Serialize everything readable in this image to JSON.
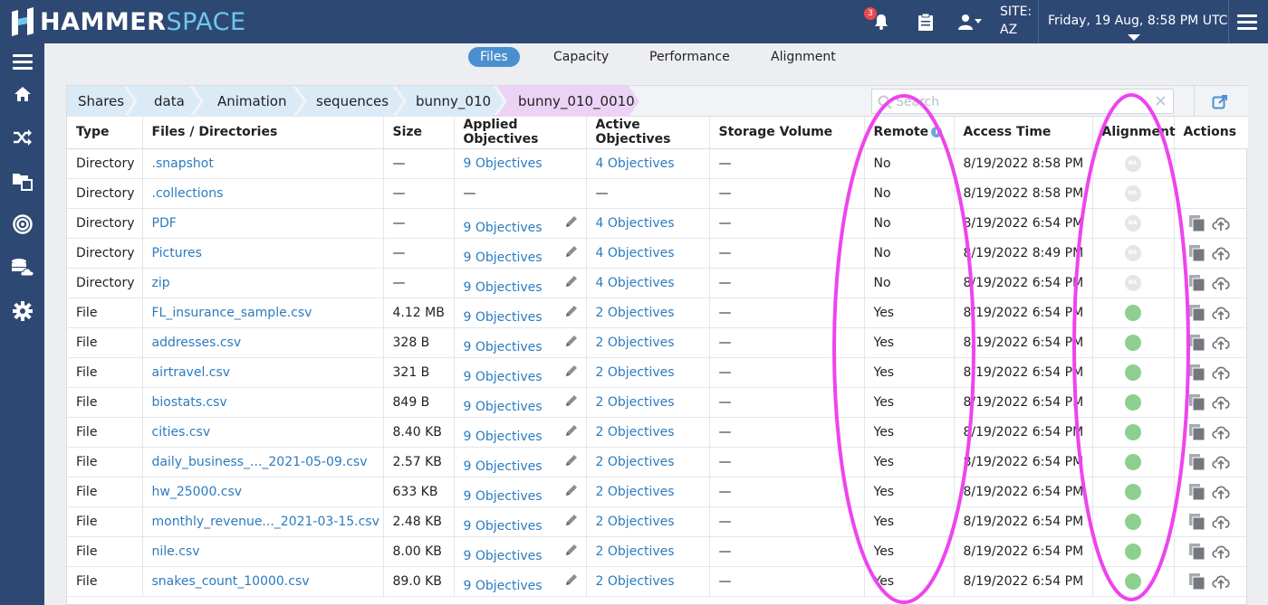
{
  "app": {
    "logo_hammer": "HAMMER",
    "logo_space": "SPACE",
    "notifications_count": "3",
    "site_label": "SITE:",
    "site_value": "AZ",
    "datetime": "Friday, 19 Aug, 8:58 PM UTC"
  },
  "tabs": [
    "Files",
    "Capacity",
    "Performance",
    "Alignment"
  ],
  "breadcrumb": [
    "Shares",
    "data",
    "Animation",
    "sequences",
    "bunny_010",
    "bunny_010_0010"
  ],
  "search": {
    "placeholder": "Search",
    "value": ""
  },
  "table": {
    "headers": {
      "type": "Type",
      "name": "Files / Directories",
      "size": "Size",
      "applied": "Applied Objectives",
      "active": "Active Objectives",
      "volume": "Storage Volume",
      "remote": "Remote",
      "access": "Access Time",
      "alignment": "Alignment",
      "actions": "Actions"
    },
    "rows": [
      {
        "type": "Directory",
        "name": ".snapshot",
        "size": "—",
        "applied": "9 Objectives",
        "applied_edit": false,
        "active": "4 Objectives",
        "volume": "—",
        "remote": "No",
        "access": "8/19/2022 8:58 PM",
        "alignment": "na",
        "actions": false
      },
      {
        "type": "Directory",
        "name": ".collections",
        "size": "—",
        "applied": "—",
        "applied_edit": false,
        "active": "—",
        "volume": "—",
        "remote": "No",
        "access": "8/19/2022 8:58 PM",
        "alignment": "na",
        "actions": false
      },
      {
        "type": "Directory",
        "name": "PDF",
        "size": "—",
        "applied": "9 Objectives",
        "applied_edit": true,
        "active": "4 Objectives",
        "volume": "—",
        "remote": "No",
        "access": "8/19/2022 6:54 PM",
        "alignment": "na",
        "actions": true
      },
      {
        "type": "Directory",
        "name": "Pictures",
        "size": "—",
        "applied": "9 Objectives",
        "applied_edit": true,
        "active": "4 Objectives",
        "volume": "—",
        "remote": "No",
        "access": "8/19/2022 8:49 PM",
        "alignment": "na",
        "actions": true
      },
      {
        "type": "Directory",
        "name": "zip",
        "size": "—",
        "applied": "9 Objectives",
        "applied_edit": true,
        "active": "4 Objectives",
        "volume": "—",
        "remote": "No",
        "access": "8/19/2022 6:54 PM",
        "alignment": "na",
        "actions": true
      },
      {
        "type": "File",
        "name": "FL_insurance_sample.csv",
        "size": "4.12 MB",
        "applied": "9 Objectives",
        "applied_edit": true,
        "active": "2 Objectives",
        "volume": "—",
        "remote": "Yes",
        "access": "8/19/2022 6:54 PM",
        "alignment": "aligned",
        "actions": true
      },
      {
        "type": "File",
        "name": "addresses.csv",
        "size": "328 B",
        "applied": "9 Objectives",
        "applied_edit": true,
        "active": "2 Objectives",
        "volume": "—",
        "remote": "Yes",
        "access": "8/19/2022 6:54 PM",
        "alignment": "aligned",
        "actions": true
      },
      {
        "type": "File",
        "name": "airtravel.csv",
        "size": "321 B",
        "applied": "9 Objectives",
        "applied_edit": true,
        "active": "2 Objectives",
        "volume": "—",
        "remote": "Yes",
        "access": "8/19/2022 6:54 PM",
        "alignment": "aligned",
        "actions": true
      },
      {
        "type": "File",
        "name": "biostats.csv",
        "size": "849 B",
        "applied": "9 Objectives",
        "applied_edit": true,
        "active": "2 Objectives",
        "volume": "—",
        "remote": "Yes",
        "access": "8/19/2022 6:54 PM",
        "alignment": "aligned",
        "actions": true
      },
      {
        "type": "File",
        "name": "cities.csv",
        "size": "8.40 KB",
        "applied": "9 Objectives",
        "applied_edit": true,
        "active": "2 Objectives",
        "volume": "—",
        "remote": "Yes",
        "access": "8/19/2022 6:54 PM",
        "alignment": "aligned",
        "actions": true
      },
      {
        "type": "File",
        "name": "daily_business_..._2021-05-09.csv",
        "size": "2.57 KB",
        "applied": "9 Objectives",
        "applied_edit": true,
        "active": "2 Objectives",
        "volume": "—",
        "remote": "Yes",
        "access": "8/19/2022 6:54 PM",
        "alignment": "aligned",
        "actions": true
      },
      {
        "type": "File",
        "name": "hw_25000.csv",
        "size": "633 KB",
        "applied": "9 Objectives",
        "applied_edit": true,
        "active": "2 Objectives",
        "volume": "—",
        "remote": "Yes",
        "access": "8/19/2022 6:54 PM",
        "alignment": "aligned",
        "actions": true
      },
      {
        "type": "File",
        "name": "monthly_revenue..._2021-03-15.csv",
        "size": "2.48 KB",
        "applied": "9 Objectives",
        "applied_edit": true,
        "active": "2 Objectives",
        "volume": "—",
        "remote": "Yes",
        "access": "8/19/2022 6:54 PM",
        "alignment": "aligned",
        "actions": true
      },
      {
        "type": "File",
        "name": "nile.csv",
        "size": "8.00 KB",
        "applied": "9 Objectives",
        "applied_edit": true,
        "active": "2 Objectives",
        "volume": "—",
        "remote": "Yes",
        "access": "8/19/2022 6:54 PM",
        "alignment": "aligned",
        "actions": true
      },
      {
        "type": "File",
        "name": "snakes_count_10000.csv",
        "size": "89.0 KB",
        "applied": "9 Objectives",
        "applied_edit": true,
        "active": "2 Objectives",
        "volume": "—",
        "remote": "Yes",
        "access": "8/19/2022 6:54 PM",
        "alignment": "aligned",
        "actions": true
      }
    ]
  },
  "alignment_na_text": "NA",
  "colors": {
    "topbar": "#2e4874",
    "accent": "#4a8fd0",
    "link": "#2b7bbf",
    "aligned": "#8dcf8f",
    "annotation": "#ee44ee"
  }
}
